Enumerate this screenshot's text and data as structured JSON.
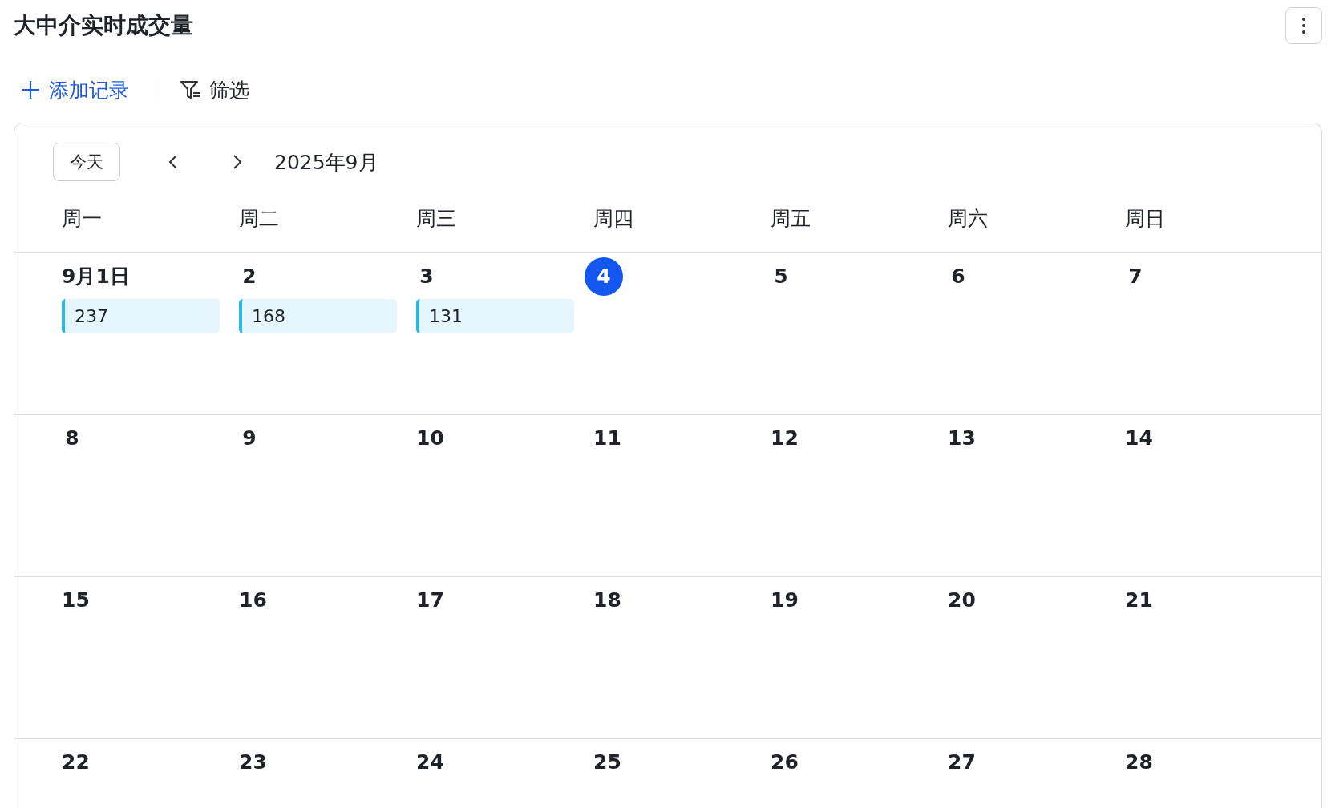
{
  "title": "大中介实时成交量",
  "toolbar": {
    "add_record": "添加记录",
    "filter": "筛选"
  },
  "calendar": {
    "today_button": "今天",
    "month": "2025年9月",
    "weekdays": [
      "周一",
      "周二",
      "周三",
      "周四",
      "周五",
      "周六",
      "周日"
    ],
    "weeks": [
      [
        {
          "label": "9月1日",
          "today": false,
          "events": [
            "237"
          ]
        },
        {
          "label": "2",
          "today": false,
          "events": [
            "168"
          ]
        },
        {
          "label": "3",
          "today": false,
          "events": [
            "131"
          ]
        },
        {
          "label": "4",
          "today": true
        },
        {
          "label": "5",
          "today": false
        },
        {
          "label": "6",
          "today": false
        },
        {
          "label": "7",
          "today": false
        }
      ],
      [
        {
          "label": "8",
          "today": false
        },
        {
          "label": "9",
          "today": false
        },
        {
          "label": "10",
          "today": false
        },
        {
          "label": "11",
          "today": false
        },
        {
          "label": "12",
          "today": false
        },
        {
          "label": "13",
          "today": false
        },
        {
          "label": "14",
          "today": false
        }
      ],
      [
        {
          "label": "15",
          "today": false
        },
        {
          "label": "16",
          "today": false
        },
        {
          "label": "17",
          "today": false
        },
        {
          "label": "18",
          "today": false
        },
        {
          "label": "19",
          "today": false
        },
        {
          "label": "20",
          "today": false
        },
        {
          "label": "21",
          "today": false
        }
      ],
      [
        {
          "label": "22",
          "today": false
        },
        {
          "label": "23",
          "today": false
        },
        {
          "label": "24",
          "today": false
        },
        {
          "label": "25",
          "today": false
        },
        {
          "label": "26",
          "today": false
        },
        {
          "label": "27",
          "today": false
        },
        {
          "label": "28",
          "today": false
        }
      ]
    ]
  }
}
